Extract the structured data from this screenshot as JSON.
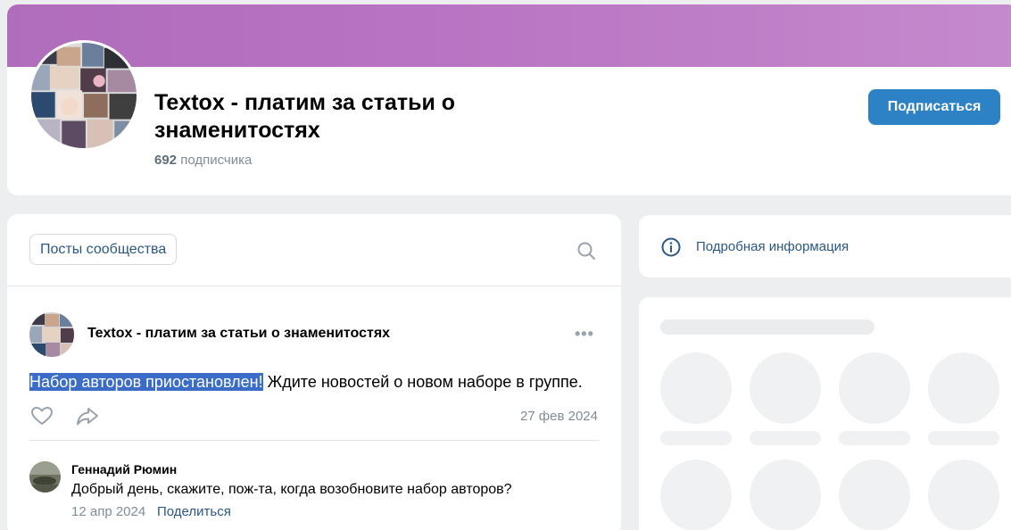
{
  "group": {
    "title": "Textox - платим за статьи о знаменитостях",
    "subscribers_count": "692",
    "subscribers_label": "подписчика",
    "subscribe_button": "Подписаться"
  },
  "feed": {
    "tab_label": "Посты сообщества",
    "post": {
      "author": "Textox - платим за статьи о знаменитостях",
      "text_highlighted": "Набор авторов приостановлен!",
      "text_rest": " Ждите новостей о новом наборе в группе.",
      "date": "27 фев 2024",
      "more_glyph": "•••"
    },
    "comment": {
      "author": "Геннадий Рюмин",
      "text": "Добрый день, скажите, пож-та, когда возобновите набор авторов?",
      "date": "12 апр 2024",
      "share_label": "Поделиться"
    }
  },
  "sidebar": {
    "info_label": "Подробная информация"
  },
  "colors": {
    "cover": "#b06dbc",
    "accent_button": "#2d81c5",
    "link": "#2a5885",
    "selection": "#3a6cc8"
  },
  "icons": [
    "search-icon",
    "more-icon",
    "like-icon",
    "share-icon",
    "info-icon"
  ]
}
